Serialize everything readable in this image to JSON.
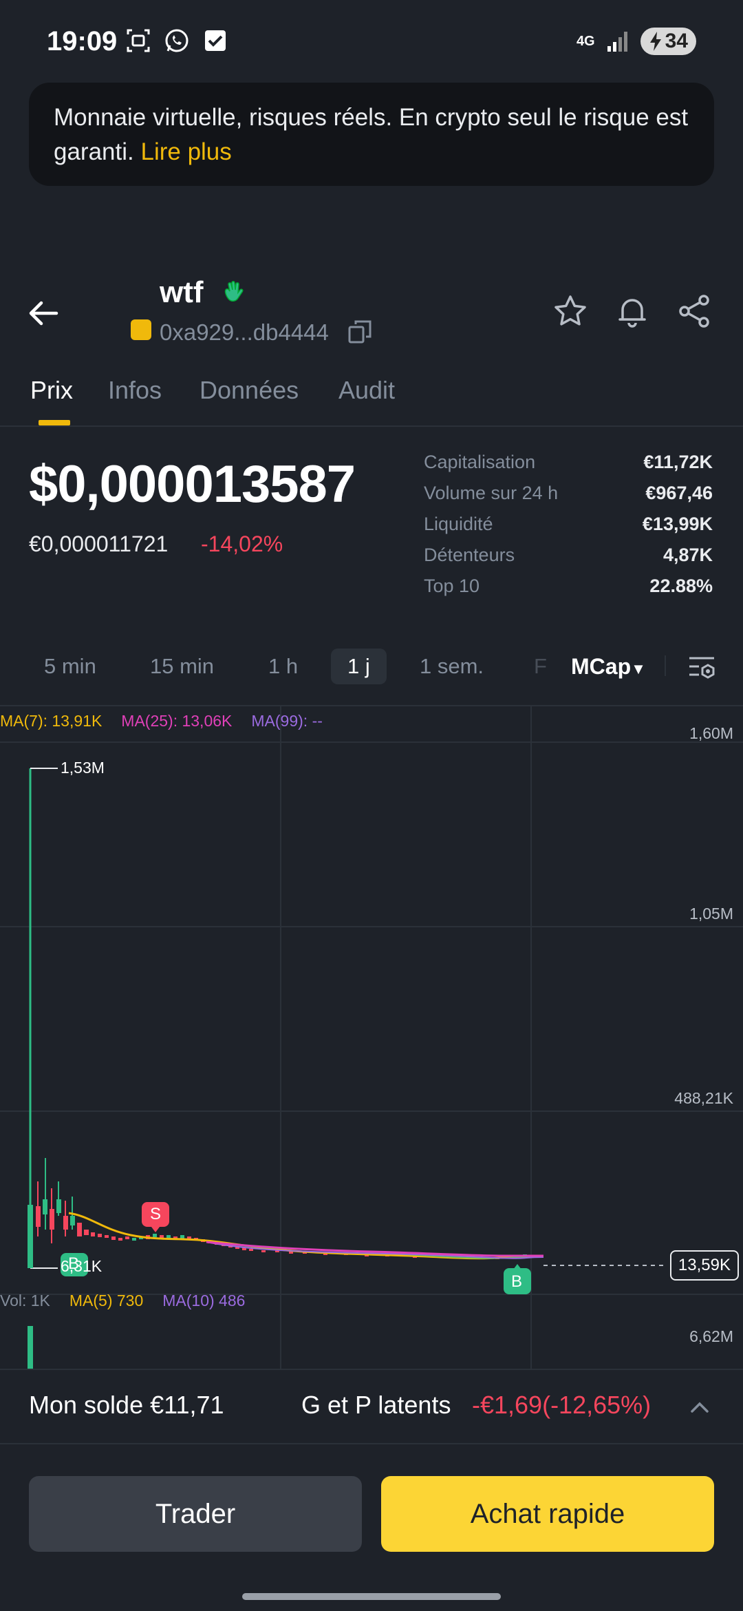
{
  "status_bar": {
    "time": "19:09",
    "network": "4G",
    "battery": "34"
  },
  "banner": {
    "text": "Monnaie virtuelle, risques réels. En crypto seul le risque est garanti.",
    "link": "Lire plus"
  },
  "header": {
    "token_name": "wtf",
    "address": "0xa929...db4444"
  },
  "tabs": [
    "Prix",
    "Infos",
    "Données",
    "Audit"
  ],
  "price": {
    "usd": "$0,000013587",
    "eur": "€0,000011721",
    "change": "-14,02%"
  },
  "stats": [
    {
      "label": "Capitalisation",
      "value": "€11,72K"
    },
    {
      "label": "Volume sur 24 h",
      "value": "€967,46"
    },
    {
      "label": "Liquidité",
      "value": "€13,99K"
    },
    {
      "label": "Détenteurs",
      "value": "4,87K"
    },
    {
      "label": "Top 10",
      "value": "22.88%"
    }
  ],
  "intervals": [
    "5 min",
    "15 min",
    "1 h",
    "1 j",
    "1 sem.",
    "F"
  ],
  "mcap_label": "MCap",
  "chart": {
    "ma_legend": {
      "ma7": "MA(7): 13,91K",
      "ma25": "MA(25): 13,06K",
      "ma99": "MA(99): --"
    },
    "y_labels": [
      "1,60M",
      "1,05M",
      "488,21K"
    ],
    "high_label": "1,53M",
    "low_label": "6,31K",
    "current_price": "13,59K",
    "vol_legend": {
      "vol": "Vol: 1K",
      "ma5": "MA(5) 730",
      "ma10": "MA(10) 486"
    },
    "vol_axis": "6,62M",
    "markers": {
      "sell": "S",
      "buy": "B"
    },
    "colors": {
      "up": "#2ebd85",
      "down": "#f6465d",
      "ma7": "#f0b90b",
      "ma25": "#e040b8",
      "ma99": "#9b6be0"
    }
  },
  "balance": {
    "label": "Mon solde €11,71",
    "pnl_label": "G et P latents",
    "pnl_value": "-€1,69(-12,65%)"
  },
  "buttons": {
    "trade": "Trader",
    "quick_buy": "Achat rapide"
  }
}
